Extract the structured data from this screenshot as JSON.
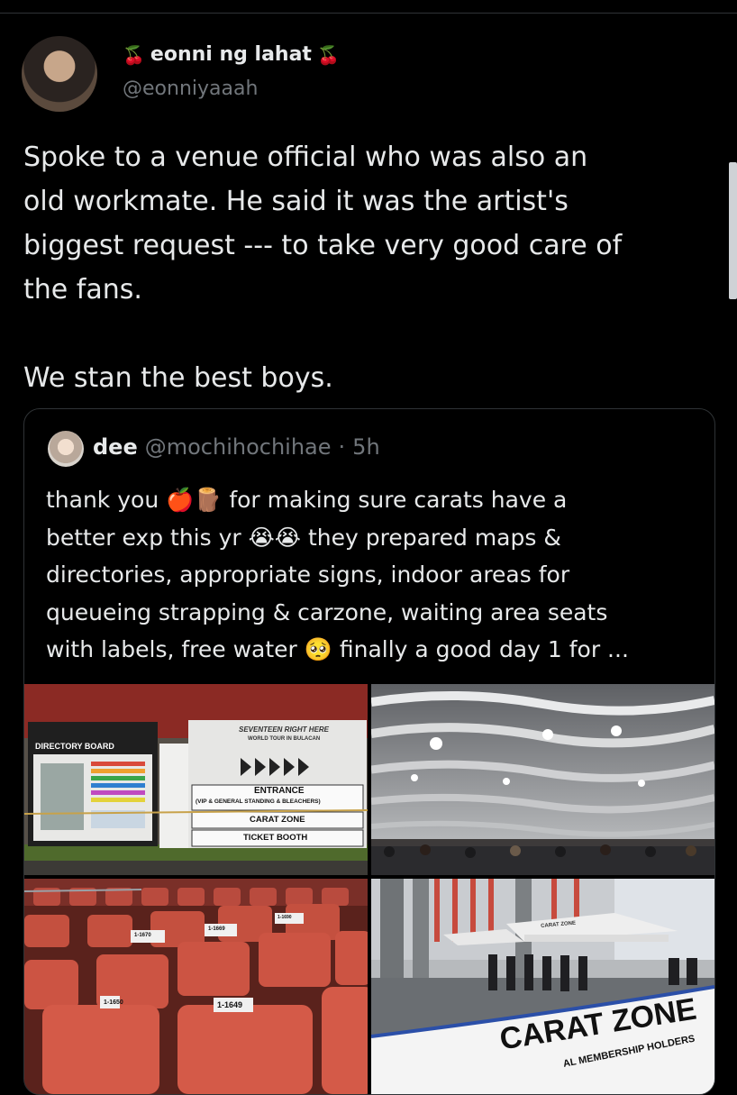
{
  "author": {
    "name": "eonni ng lahat",
    "handle": "@eonniyaaah",
    "emoji_left": "🍒",
    "emoji_right": "🍒"
  },
  "tweet": {
    "text": "Spoke to a venue official who was also an\nold workmate. He said it was the artist's\nbiggest request --- to take very good care of\nthe fans.\n\nWe stan the best boys."
  },
  "quote": {
    "name": "dee",
    "handle": "@mochihochihae",
    "separator": "·",
    "time": "5h",
    "text": "thank you 🍎🪵 for making sure carats have a\nbetter exp this yr 😭😭 they prepared maps &\ndirectories, appropriate signs, indoor areas for\nqueueing strapping & carzone, waiting area seats\nwith labels, free water 🥺 finally a good day 1 for ..."
  },
  "images": {
    "img1": {
      "directory_board": "DIRECTORY BOARD",
      "sign_title": "SEVENTEEN RIGHT HERE",
      "sign_sub": "WORLD TOUR IN BULACAN",
      "entrance": "ENTRANCE",
      "entrance_sub": "(VIP & GENERAL STANDING & BLEACHERS)",
      "carat_zone": "CARAT ZONE",
      "ticket_booth": "TICKET BOOTH"
    },
    "img3": {
      "seat_a": "1-1650",
      "seat_b": "1-1649",
      "seat_c": "1-1670",
      "seat_d": "1-1669",
      "seat_e": "1-1690"
    },
    "img4": {
      "banner_title": "CARAT ZONE",
      "banner_sub": "AL MEMBERSHIP HOLDERS",
      "tent_sign": "CARAT ZONE"
    }
  },
  "colors": {
    "background": "#000000",
    "text": "#e7e9ea",
    "muted": "#71767b",
    "border": "#2f3336"
  }
}
